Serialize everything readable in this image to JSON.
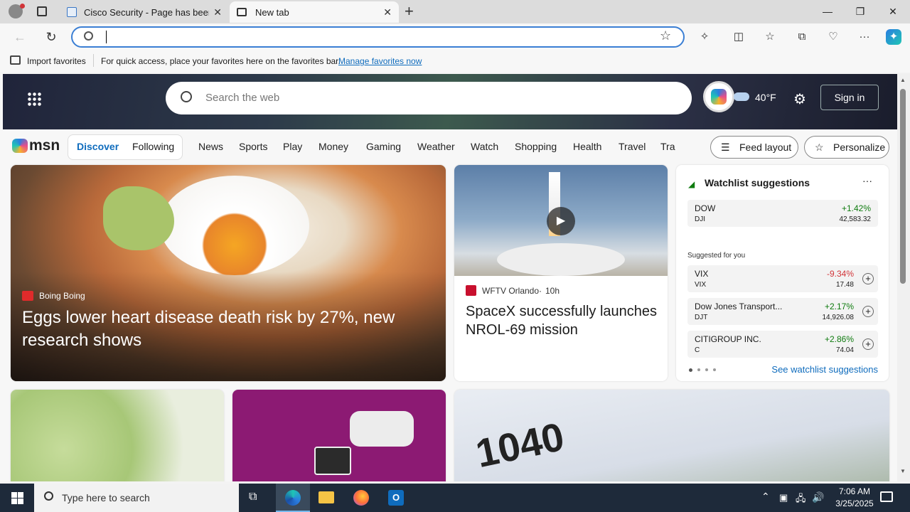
{
  "browser": {
    "tabs": [
      {
        "title": "Cisco Security - Page has been bl"
      },
      {
        "title": "New tab"
      }
    ],
    "address_value": "",
    "favorites_bar": {
      "import": "Import favorites",
      "hint": "For quick access, place your favorites here on the favorites bar.",
      "manage": "Manage favorites now"
    }
  },
  "msn": {
    "search_placeholder": "Search the web",
    "weather": "40°F",
    "sign_in": "Sign in",
    "logo": "msn",
    "tabs": [
      "Discover",
      "Following"
    ],
    "nav": [
      "News",
      "Sports",
      "Play",
      "Money",
      "Gaming",
      "Weather",
      "Watch",
      "Shopping",
      "Health",
      "Travel",
      "Tra"
    ],
    "feed_layout": "Feed layout",
    "personalize": "Personalize",
    "hero": {
      "source": "Boing Boing",
      "headline": "Eggs lower heart disease death risk by 27%, new research shows"
    },
    "story2": {
      "source": "WFTV Orlando",
      "age": "10h",
      "headline": "SpaceX successfully launches NROL-69 mission"
    },
    "watchlist": {
      "title": "Watchlist suggestions",
      "more": "···",
      "top": {
        "name": "DOW",
        "symbol": "DJI",
        "change": "+1.42%",
        "price": "42,583.32"
      },
      "suggested_label": "Suggested for you",
      "items": [
        {
          "name": "VIX",
          "symbol": "VIX",
          "change": "-9.34%",
          "price": "17.48"
        },
        {
          "name": "Dow Jones Transport...",
          "symbol": "DJT",
          "change": "+2.17%",
          "price": "14,926.08"
        },
        {
          "name": "CITIGROUP INC.",
          "symbol": "C",
          "change": "+2.86%",
          "price": "74.04"
        }
      ],
      "see_all": "See watchlist suggestions"
    },
    "tax_card_text": "1040"
  },
  "taskbar": {
    "search_placeholder": "Type here to search",
    "time": "7:06 AM",
    "date": "3/25/2025"
  },
  "colors": {
    "up": "#0f7b0f",
    "down": "#d13438",
    "accent": "#0f6cbd"
  }
}
